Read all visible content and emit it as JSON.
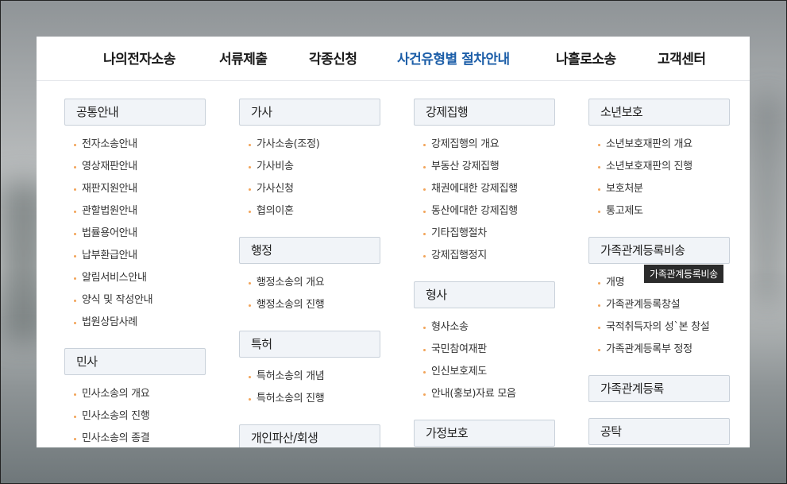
{
  "nav": [
    "나의전자소송",
    "서류제출",
    "각종신청",
    "사건유형별 절차안내",
    "나홀로소송",
    "고객센터"
  ],
  "nav_active_index": 3,
  "columns": [
    {
      "groups": [
        {
          "title": "공통안내",
          "items": [
            "전자소송안내",
            "영상재판안내",
            "재판지원안내",
            "관할법원안내",
            "법률용어안내",
            "납부환급안내",
            "알림서비스안내",
            "양식 및 작성안내",
            "법원상담사례"
          ]
        },
        {
          "title": "민사",
          "items": [
            "민사소송의 개요",
            "민사소송의 진행",
            "민사소송의 종결"
          ]
        }
      ]
    },
    {
      "groups": [
        {
          "title": "가사",
          "items": [
            "가사소송(조정)",
            "가사비송",
            "가사신청",
            "협의이혼"
          ]
        },
        {
          "title": "행정",
          "items": [
            "행정소송의 개요",
            "행정소송의 진행"
          ]
        },
        {
          "title": "특허",
          "items": [
            "특허소송의 개념",
            "특허소송의 진행"
          ]
        },
        {
          "title": "개인파산/회생",
          "items": []
        }
      ]
    },
    {
      "groups": [
        {
          "title": "강제집행",
          "items": [
            "강제집행의 개요",
            "부동산 강제집행",
            "채권에대한 강제집행",
            "동산에대한 강제집행",
            "기타집행절차",
            "강제집행정지"
          ]
        },
        {
          "title": "형사",
          "items": [
            "형사소송",
            "국민참여재판",
            "인신보호제도",
            "안내(홍보)자료 모음"
          ]
        },
        {
          "title": "가정보호",
          "items": []
        }
      ]
    },
    {
      "groups": [
        {
          "title": "소년보호",
          "items": [
            "소년보호재판의 개요",
            "소년보호재판의 진행",
            "보호처분",
            "통고제도"
          ]
        },
        {
          "title": "가족관계등록비송",
          "items": [
            "개명",
            "가족관계등록창설",
            "국적취득자의 성`본 창설",
            "가족관계등록부 정정"
          ]
        },
        {
          "title": "가족관계등록",
          "items": []
        },
        {
          "title": "공탁",
          "items": []
        }
      ]
    }
  ],
  "tooltip": {
    "text": "가족관계등록비송"
  }
}
